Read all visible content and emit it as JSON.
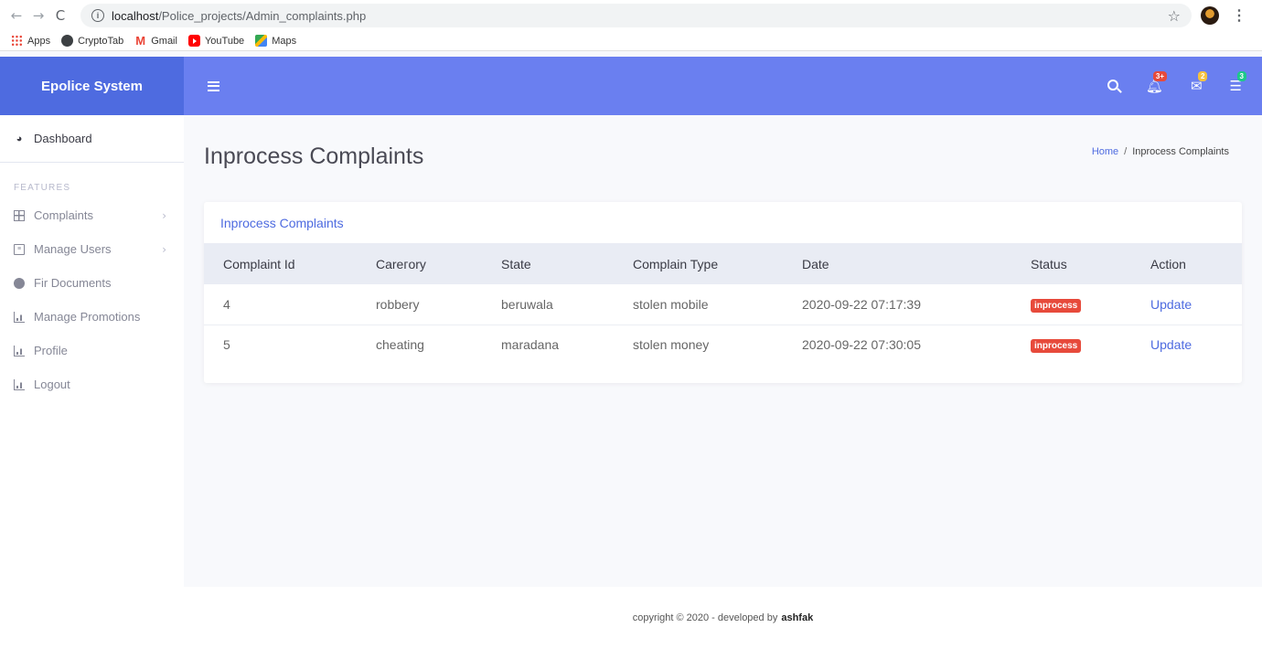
{
  "browser": {
    "url_host": "localhost",
    "url_path": "/Police_projects/Admin_complaints.php",
    "bookmarks": [
      "Apps",
      "CryptoTab",
      "Gmail",
      "YouTube",
      "Maps"
    ]
  },
  "brand": "Epolice System",
  "sidebar": {
    "dashboard": "Dashboard",
    "heading": "FEATURES",
    "items": [
      {
        "label": "Complaints",
        "icon": "table-icon",
        "has_arrow": true
      },
      {
        "label": "Manage Users",
        "icon": "list-icon",
        "has_arrow": true
      },
      {
        "label": "Fir Documents",
        "icon": "palette-icon",
        "has_arrow": false
      },
      {
        "label": "Manage Promotions",
        "icon": "chart-icon",
        "has_arrow": false
      },
      {
        "label": "Profile",
        "icon": "chart-icon",
        "has_arrow": false
      },
      {
        "label": "Logout",
        "icon": "chart-icon",
        "has_arrow": false
      }
    ]
  },
  "topbar": {
    "alerts_count": "3+",
    "messages_count": "2",
    "tasks_count": "3"
  },
  "page": {
    "title": "Inprocess Complaints",
    "breadcrumb_home": "Home",
    "breadcrumb_sep": "/",
    "breadcrumb_current": "Inprocess Complaints"
  },
  "card": {
    "title": "Inprocess Complaints",
    "columns": [
      "Complaint Id",
      "Carегory",
      "State",
      "Complain Type",
      "Date",
      "Status",
      "Action"
    ],
    "rows": [
      {
        "id": "4",
        "category": "robbery",
        "state": "beruwala",
        "type": "stolen mobile",
        "date": "2020-09-22 07:17:39",
        "status": "inprocess",
        "action": "Update"
      },
      {
        "id": "5",
        "category": "cheating",
        "state": "maradana",
        "type": "stolen money",
        "date": "2020-09-22 07:30:05",
        "status": "inprocess",
        "action": "Update"
      }
    ]
  },
  "footer": {
    "text": "copyright © 2020 - developed by",
    "author": "ashfak"
  },
  "colors": {
    "brand": "#4e6be0",
    "topbar": "#6a7ff0",
    "danger": "#e74a3b"
  }
}
